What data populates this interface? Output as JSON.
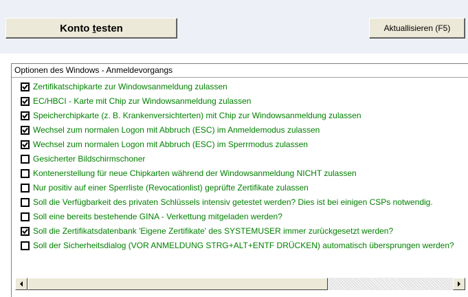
{
  "toolbar": {
    "test_label_pre": "Konto ",
    "test_label_mnemonic": "t",
    "test_label_post": "esten",
    "refresh_label": "Aktuallisieren (F5)"
  },
  "options_panel": {
    "header": "Optionen des Windows - Anmeldevorgangs",
    "items": [
      {
        "label": "Zertifikatschipkarte zur Windowsanmeldung zulassen",
        "checked": true
      },
      {
        "label": "EC/HBCI - Karte mit Chip zur Windowsanmeldung zulassen",
        "checked": true
      },
      {
        "label": "Speicherchipkarte (z. B. Krankenversichterten) mit Chip zur Windowsanmeldung zulassen",
        "checked": true
      },
      {
        "label": "Wechsel zum normalen Logon mit Abbruch (ESC) im Anmeldemodus zulassen",
        "checked": true
      },
      {
        "label": "Wechsel zum normalen Logon mit Abbruch (ESC) im Sperrmodus zulassen",
        "checked": true
      },
      {
        "label": "Gesicherter Bildschirmschoner",
        "checked": false
      },
      {
        "label": "Kontenerstellung für neue Chipkarten während der Windowsanmeldung NICHT zulassen",
        "checked": false
      },
      {
        "label": "Nur positiv auf einer Sperrliste (Revocationlist) geprüfte Zertifikate zulassen",
        "checked": false
      },
      {
        "label": "Soll die Verfügbarkeit des privaten Schlüssels intensiv getestet werden? Dies ist bei einigen CSPs notwendig.",
        "checked": false
      },
      {
        "label": "Soll eine bereits bestehende GINA - Verkettung mitgeladen werden?",
        "checked": false
      },
      {
        "label": "Soll die Zertifikatsdatenbank 'Eigene Zertifikate' des SYSTEMUSER immer zurückgesetzt werden?",
        "checked": true
      },
      {
        "label": "Soll der Sicherheitsdialog (VOR ANMELDUNG STRG+ALT+ENTF DRÜCKEN) automatisch übersprungen werden?",
        "checked": false
      }
    ]
  },
  "colors": {
    "option_text": "#008000",
    "button_face": "#ece9d8",
    "top_strip": "#eef0f8"
  },
  "icons": {
    "scroll_left": "arrow-left-icon",
    "scroll_right": "arrow-right-icon",
    "checkmark": "check-icon"
  }
}
